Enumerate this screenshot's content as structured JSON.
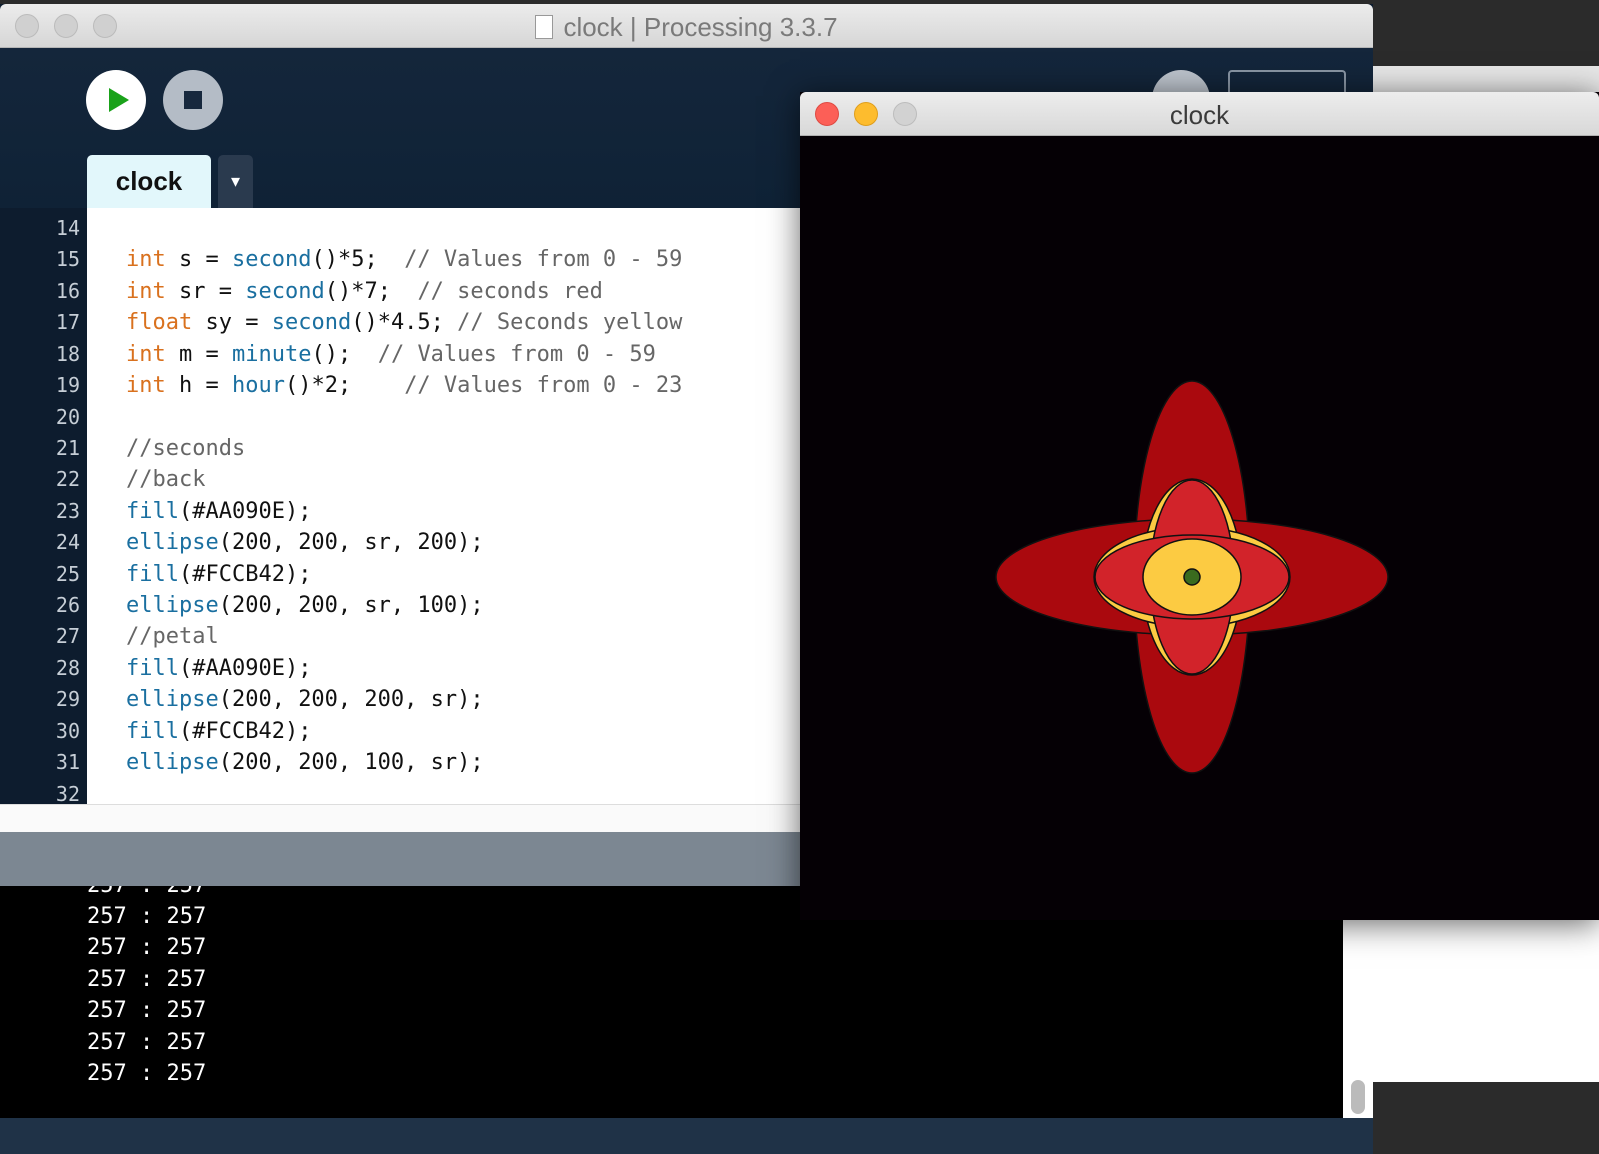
{
  "main_window": {
    "title": "clock | Processing 3.3.7"
  },
  "sketch_window": {
    "title": "clock"
  },
  "tabs": [
    {
      "label": "clock"
    },
    {
      "label": "▾"
    }
  ],
  "editor": {
    "line_numbers": [
      "14",
      "15",
      "16",
      "17",
      "18",
      "19",
      "20",
      "21",
      "22",
      "23",
      "24",
      "25",
      "26",
      "27",
      "28",
      "29",
      "30",
      "31",
      "32"
    ]
  },
  "console": {
    "lines": [
      "257 : 257",
      "257 : 257",
      "257 : 257",
      "257 : 257",
      "257 : 257",
      "257 : 257"
    ]
  },
  "colors": {
    "dark_red": "#AA090E",
    "yellow": "#FCCB42",
    "red": "#D2232A",
    "center_green": "#3a6b1e"
  }
}
